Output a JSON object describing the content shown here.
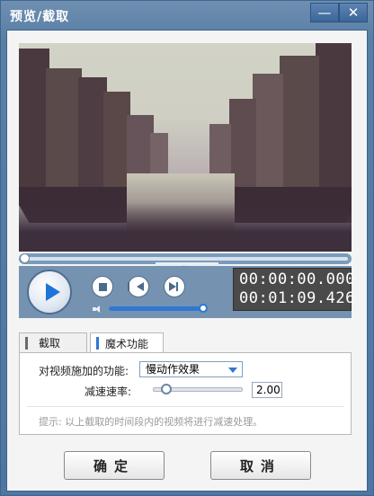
{
  "window": {
    "title": "预览/截取",
    "minimize_glyph": "—",
    "close_glyph": "✕"
  },
  "player": {
    "time_current": "00:00:00.000",
    "time_total": "00:01:09.426",
    "volume_fraction": 0.95,
    "seek_fraction": 0.0
  },
  "tabs": [
    {
      "label": "截取",
      "active": false
    },
    {
      "label": "魔术功能",
      "active": true
    }
  ],
  "magic": {
    "function_label": "对视频施加的功能:",
    "function_value": "慢动作效果",
    "speed_label": "减速速率:",
    "speed_value": "2.00",
    "speed_fraction": 0.0,
    "hint": "提示: 以上截取的时间段内的视频将进行减速处理。"
  },
  "buttons": {
    "ok": "确定",
    "cancel": "取消"
  },
  "colors": {
    "accent": "#2e78d3",
    "tab_cut_mark": "#6a6a6a",
    "tab_magic_mark": "#2e78d3"
  }
}
